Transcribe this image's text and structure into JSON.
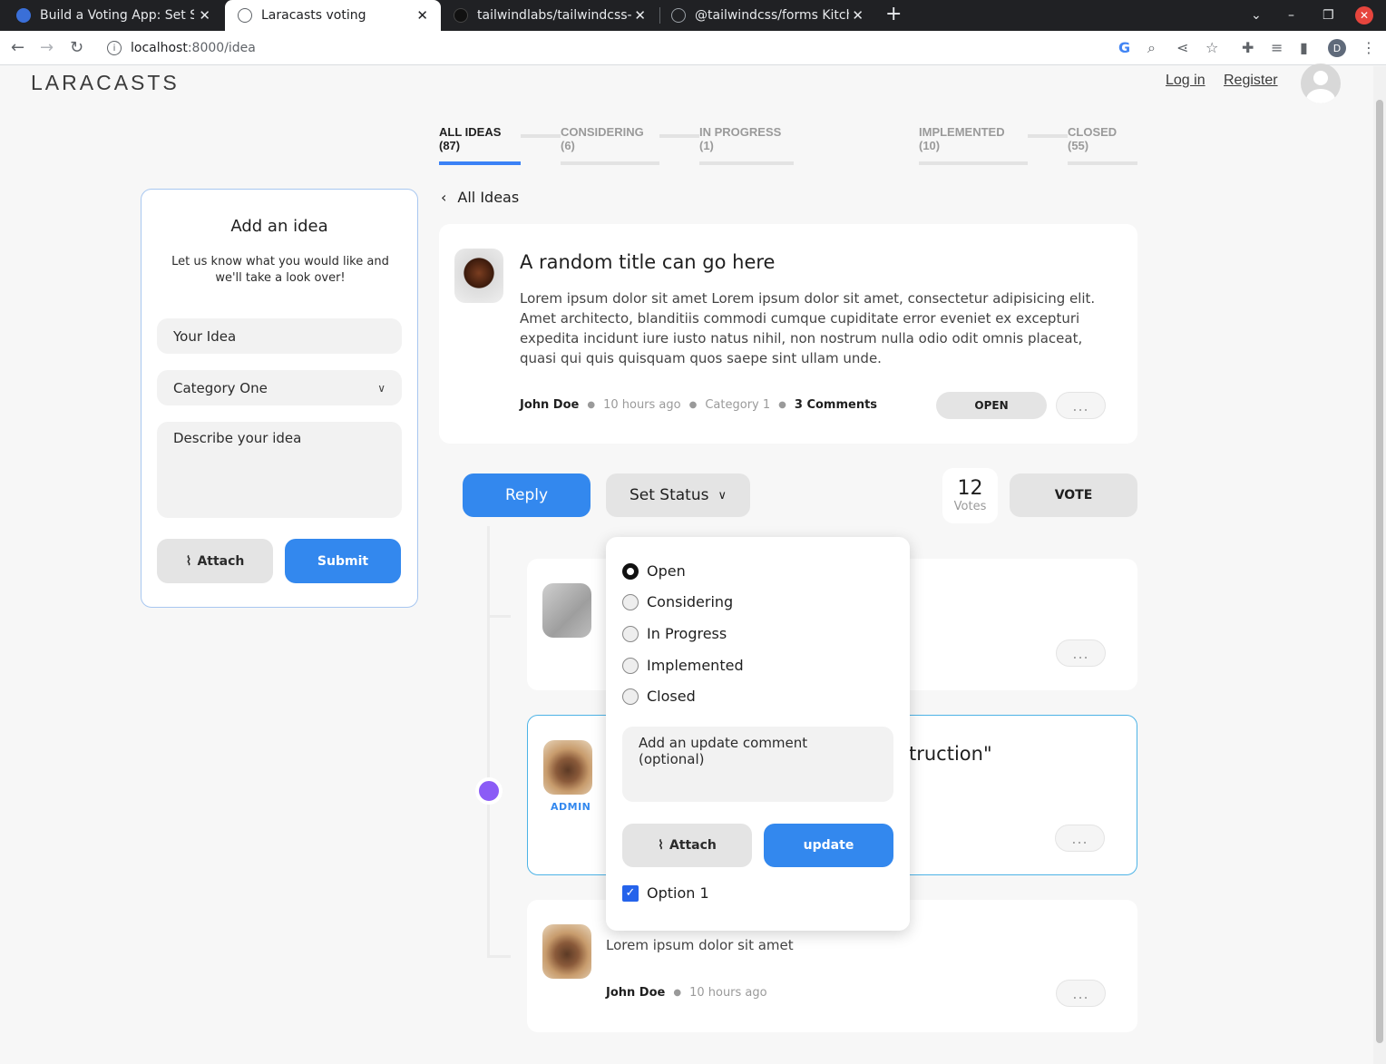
{
  "browser": {
    "tabs": [
      {
        "title": "Build a Voting App: Set St",
        "active": false
      },
      {
        "title": "Laracasts voting",
        "active": true
      },
      {
        "title": "tailwindlabs/tailwindcss-",
        "active": false
      },
      {
        "title": "@tailwindcss/forms Kitch",
        "active": false
      }
    ],
    "url_host": "localhost",
    "url_path": ":8000/idea",
    "profile_initial": "D"
  },
  "header": {
    "logo": "LARACASTS",
    "login": "Log in",
    "register": "Register"
  },
  "filters": [
    {
      "label": "ALL IDEAS (87)",
      "active": true
    },
    {
      "label": "CONSIDERING (6)",
      "active": false
    },
    {
      "label": "IN PROGRESS (1)",
      "active": false
    },
    {
      "label": "IMPLEMENTED (10)",
      "active": false
    },
    {
      "label": "CLOSED (55)",
      "active": false
    }
  ],
  "sidebar": {
    "title": "Add an idea",
    "subtitle": "Let us know what you would like and we'll take a look over!",
    "idea_placeholder": "Your Idea",
    "category_value": "Category One",
    "description_placeholder": "Describe your idea",
    "attach_label": "Attach",
    "submit_label": "Submit"
  },
  "main": {
    "back_label": "All Ideas",
    "idea": {
      "title": "A random title can go here",
      "description": "Lorem ipsum dolor sit amet Lorem ipsum dolor sit amet, consectetur adipisicing elit. Amet architecto, blanditiis commodi cumque cupiditate error eveniet ex excepturi expedita incidunt iure iusto natus nihil, non nostrum nulla odio odit omnis placeat, quasi qui quis quisquam quos saepe sint ullam unde.",
      "author": "John Doe",
      "time": "10 hours ago",
      "category": "Category 1",
      "comments": "3 Comments",
      "status": "OPEN",
      "more": "..."
    },
    "actions": {
      "reply": "Reply",
      "set_status": "Set Status",
      "votes_count": "12",
      "votes_label": "Votes",
      "vote": "VOTE"
    },
    "comments": [
      {
        "more": "..."
      },
      {
        "admin_label": "ADMIN",
        "title_fragment": "truction\"",
        "more": "..."
      },
      {
        "body": "Lorem ipsum dolor sit amet",
        "author": "John Doe",
        "time": "10 hours ago",
        "more": "..."
      }
    ]
  },
  "status_dropdown": {
    "options": [
      {
        "label": "Open",
        "checked": true
      },
      {
        "label": "Considering",
        "checked": false
      },
      {
        "label": "In Progress",
        "checked": false
      },
      {
        "label": "Implemented",
        "checked": false
      },
      {
        "label": "Closed",
        "checked": false
      }
    ],
    "comment_placeholder": "Add an update comment (optional)",
    "attach_label": "Attach",
    "update_label": "update",
    "option1_label": "Option 1",
    "option1_checked": true
  }
}
